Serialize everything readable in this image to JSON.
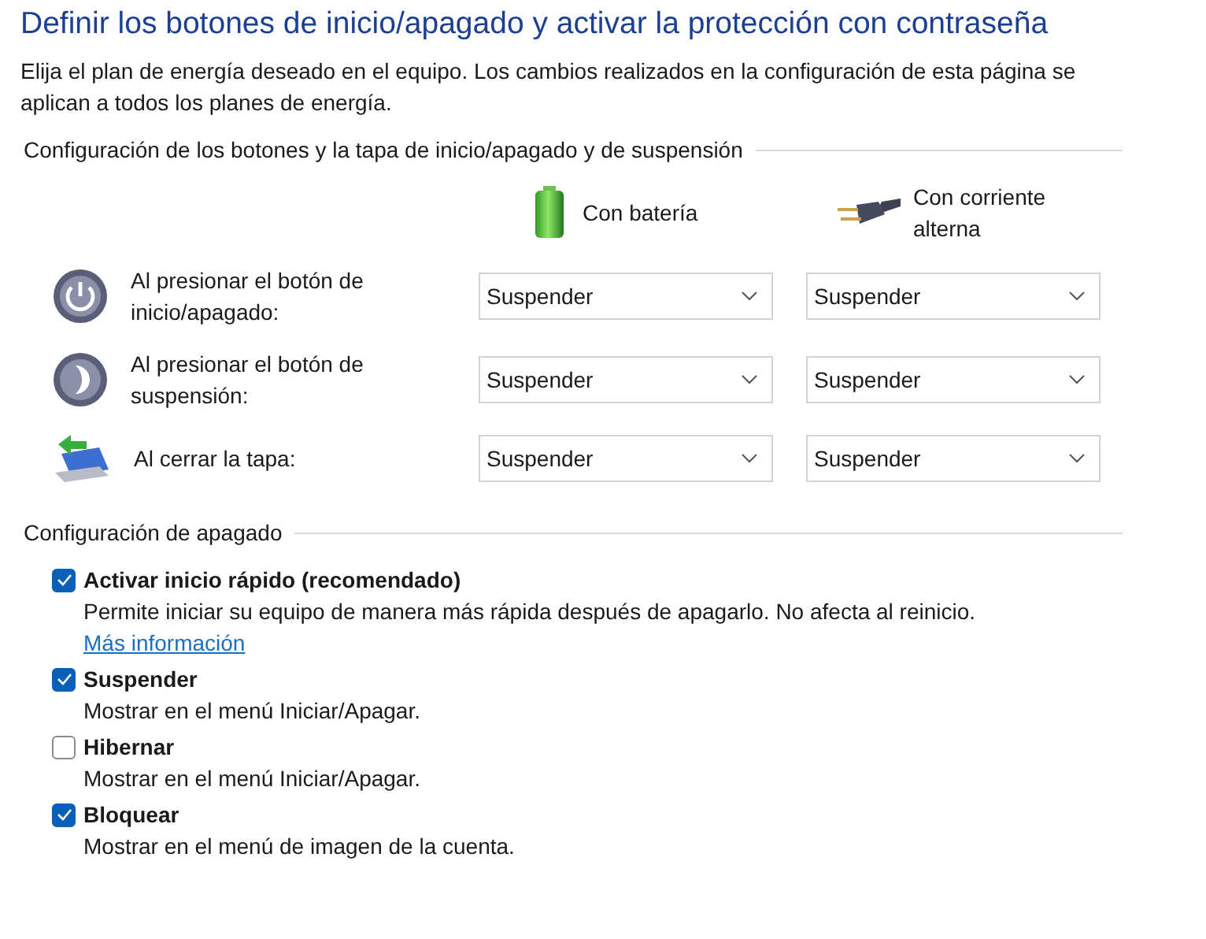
{
  "title": "Definir los botones de inicio/apagado y activar la protección con contraseña",
  "intro": "Elija el plan de energía deseado en el equipo. Los cambios realizados en la configuración de esta página se aplican a todos los planes de energía.",
  "buttons_section": {
    "heading": "Configuración de los botones y la tapa de inicio/apagado y de suspensión",
    "columns": [
      {
        "kind": "battery",
        "label": "Con batería"
      },
      {
        "kind": "plug",
        "label": "Con corriente alterna"
      }
    ],
    "rows": [
      {
        "kind": "power",
        "label": "Al presionar el botón de inicio/apagado:",
        "values": [
          "Suspender",
          "Suspender"
        ]
      },
      {
        "kind": "sleep",
        "label": "Al presionar el botón de suspensión:",
        "values": [
          "Suspender",
          "Suspender"
        ]
      },
      {
        "kind": "lid",
        "label": "Al cerrar la tapa:",
        "values": [
          "Suspender",
          "Suspender"
        ]
      }
    ]
  },
  "shutdown_section": {
    "heading": "Configuración de apagado",
    "options": [
      {
        "label": "Activar inicio rápido (recomendado)",
        "checked": true,
        "description": "Permite iniciar su equipo de manera más rápida después de apagarlo. No afecta al reinicio.",
        "link": "Más información"
      },
      {
        "label": "Suspender",
        "checked": true,
        "description": "Mostrar en el menú Iniciar/Apagar."
      },
      {
        "label": "Hibernar",
        "checked": false,
        "description": "Mostrar en el menú Iniciar/Apagar."
      },
      {
        "label": "Bloquear",
        "checked": true,
        "description": "Mostrar en el menú de imagen de la cuenta."
      }
    ]
  }
}
